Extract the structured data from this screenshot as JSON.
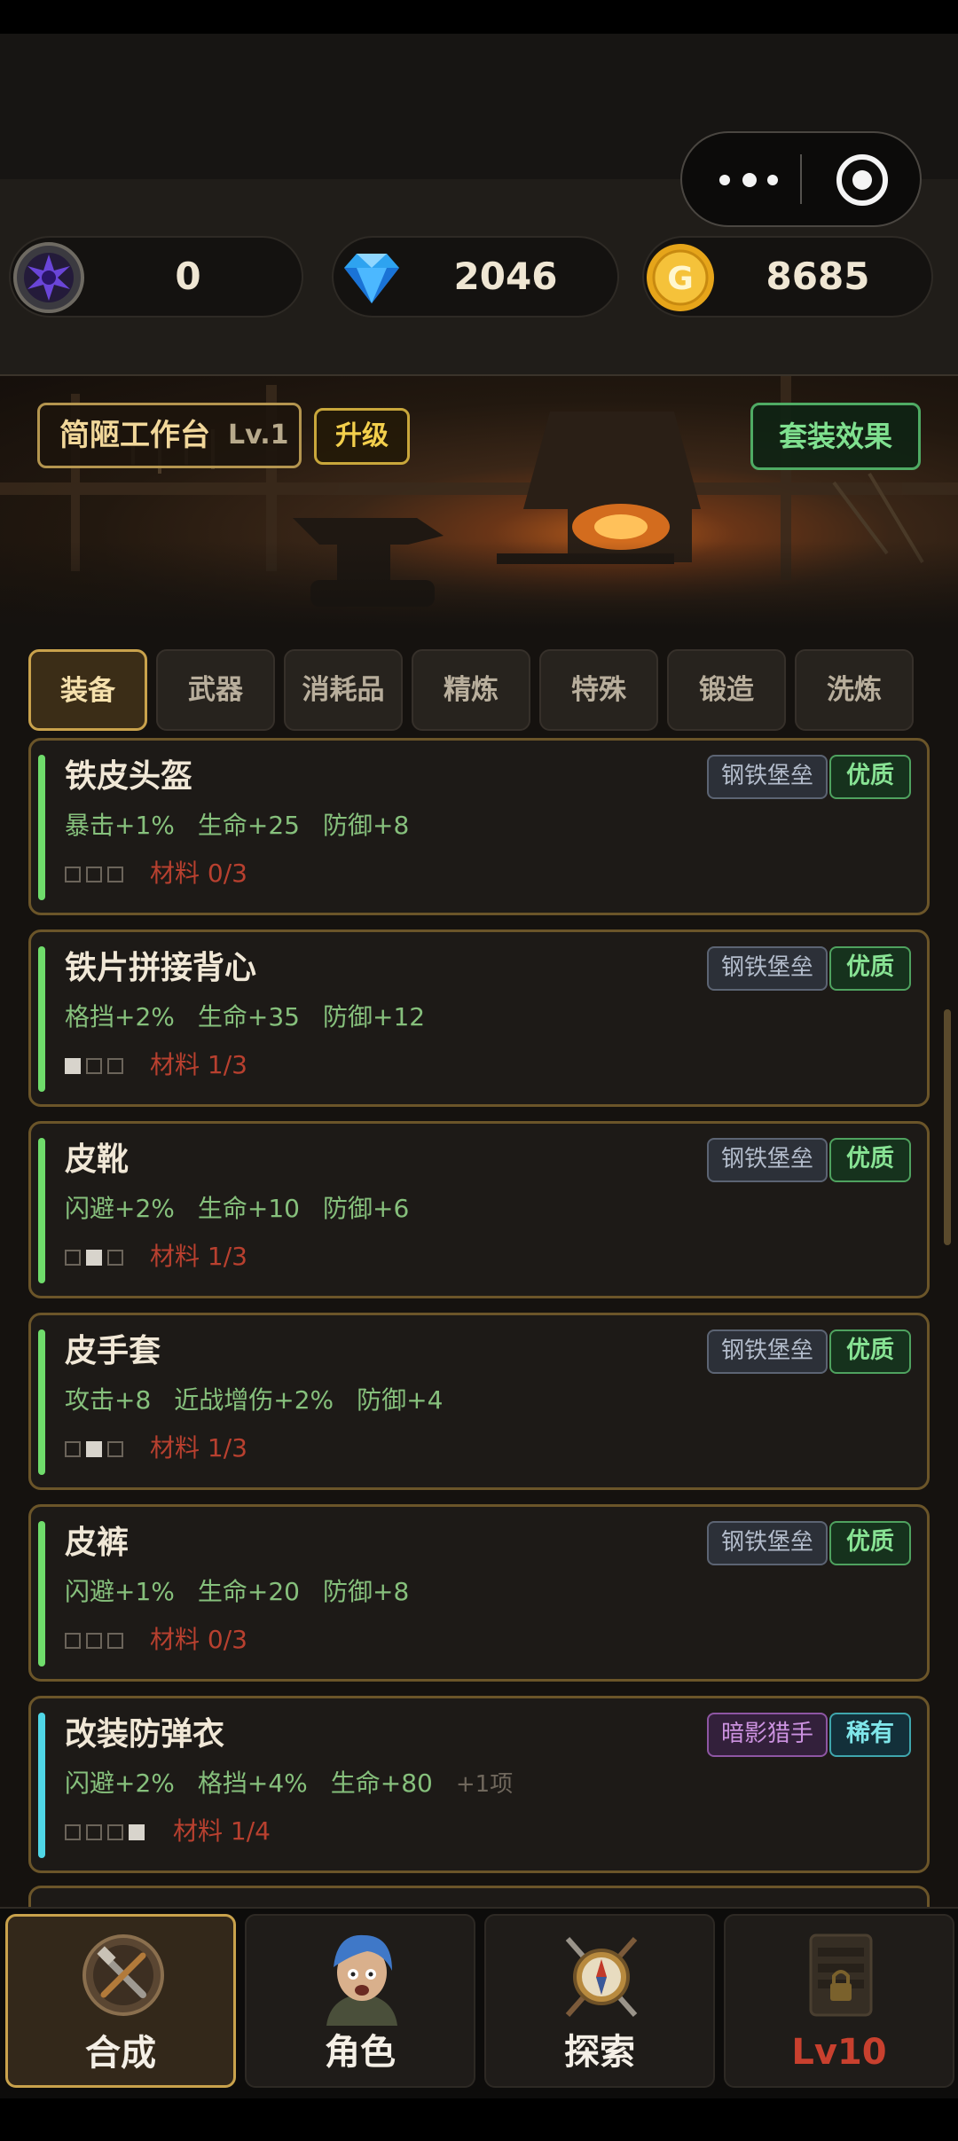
{
  "currencies": [
    {
      "icon": "purple-crystal-icon",
      "value": "0"
    },
    {
      "icon": "diamond-icon",
      "value": "2046"
    },
    {
      "icon": "gold-coin-icon",
      "value": "8685"
    }
  ],
  "workbench": {
    "name": "简陋工作台",
    "level": "Lv.1",
    "upgrade_label": "升级",
    "set_effect_label": "套装效果"
  },
  "tabs": [
    "装备",
    "武器",
    "消耗品",
    "精炼",
    "特殊",
    "锻造",
    "洗炼"
  ],
  "active_tab": "装备",
  "items": [
    {
      "name": "铁皮头盔",
      "stats": [
        "暴击+1%",
        "生命+25",
        "防御+8"
      ],
      "more": "",
      "set": "钢铁堡垒",
      "quality": "优质",
      "slots_filled": [
        false,
        false,
        false
      ],
      "materials": "材料 0/3"
    },
    {
      "name": "铁片拼接背心",
      "stats": [
        "格挡+2%",
        "生命+35",
        "防御+12"
      ],
      "more": "",
      "set": "钢铁堡垒",
      "quality": "优质",
      "slots_filled": [
        true,
        false,
        false
      ],
      "materials": "材料 1/3"
    },
    {
      "name": "皮靴",
      "stats": [
        "闪避+2%",
        "生命+10",
        "防御+6"
      ],
      "more": "",
      "set": "钢铁堡垒",
      "quality": "优质",
      "slots_filled": [
        false,
        true,
        false
      ],
      "materials": "材料 1/3"
    },
    {
      "name": "皮手套",
      "stats": [
        "攻击+8",
        "近战增伤+2%",
        "防御+4"
      ],
      "more": "",
      "set": "钢铁堡垒",
      "quality": "优质",
      "slots_filled": [
        false,
        true,
        false
      ],
      "materials": "材料 1/3"
    },
    {
      "name": "皮裤",
      "stats": [
        "闪避+1%",
        "生命+20",
        "防御+8"
      ],
      "more": "",
      "set": "钢铁堡垒",
      "quality": "优质",
      "slots_filled": [
        false,
        false,
        false
      ],
      "materials": "材料 0/3"
    },
    {
      "name": "改装防弹衣",
      "stats": [
        "闪避+2%",
        "格挡+4%",
        "生命+80"
      ],
      "more": "+1项",
      "set": "暗影猎手",
      "quality": "稀有",
      "slots_filled": [
        false,
        false,
        false,
        true
      ],
      "materials": "材料 1/4"
    }
  ],
  "bottom_nav": [
    {
      "label": "合成",
      "icon": "crafting-icon",
      "active": true,
      "locked": false
    },
    {
      "label": "角色",
      "icon": "character-icon",
      "active": false,
      "locked": false
    },
    {
      "label": "探索",
      "icon": "compass-icon",
      "active": false,
      "locked": false
    },
    {
      "label": "Lv10",
      "icon": "locked-shop-icon",
      "active": false,
      "locked": true
    }
  ],
  "colors": {
    "quality_good": "#4fa25f",
    "quality_rare": "#3fa6ad",
    "tab_active_border": "#c9a24c",
    "material_red": "#b8402f"
  }
}
